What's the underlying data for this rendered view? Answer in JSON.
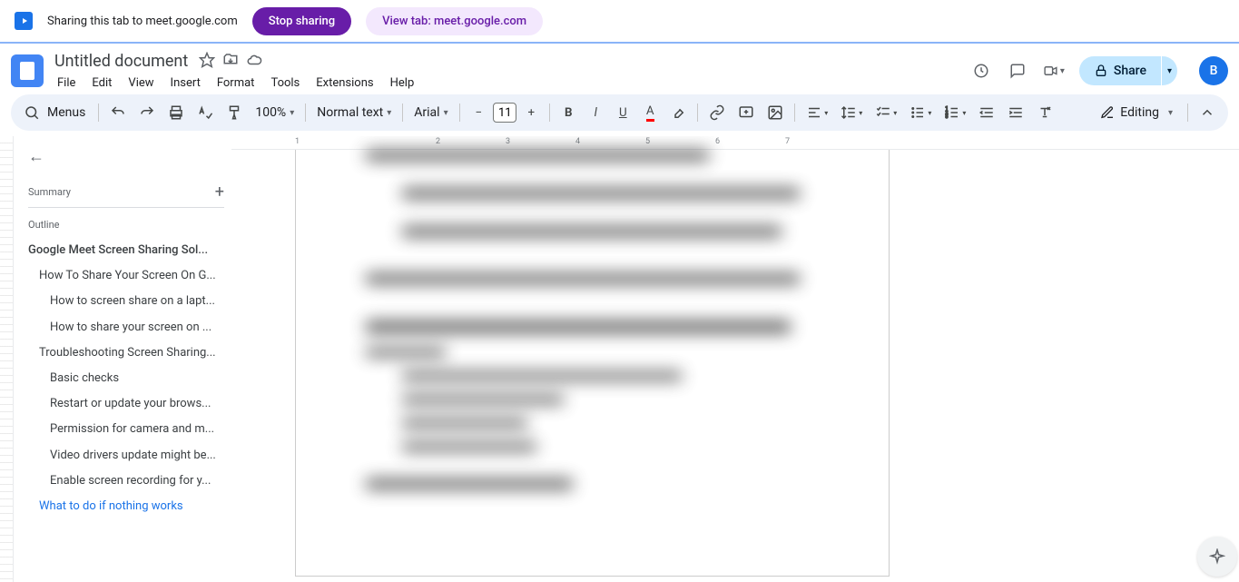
{
  "sharing_bar": {
    "text": "Sharing this tab to meet.google.com",
    "stop_label": "Stop sharing",
    "view_label": "View tab: meet.google.com"
  },
  "title_bar": {
    "doc_title": "Untitled document",
    "menus": [
      "File",
      "Edit",
      "View",
      "Insert",
      "Format",
      "Tools",
      "Extensions",
      "Help"
    ],
    "share_label": "Share",
    "avatar_letter": "B"
  },
  "toolbar": {
    "menus_label": "Menus",
    "zoom": "100%",
    "style": "Normal text",
    "font": "Arial",
    "font_size": "11",
    "editing_label": "Editing"
  },
  "outline": {
    "summary_label": "Summary",
    "outline_label": "Outline",
    "items": [
      {
        "level": 1,
        "text": "Google Meet Screen Sharing Sol...",
        "active": false
      },
      {
        "level": 2,
        "text": "How To Share Your Screen On G...",
        "active": false
      },
      {
        "level": 3,
        "text": "How to screen share on a lapt...",
        "active": false
      },
      {
        "level": 3,
        "text": "How to share your screen on ...",
        "active": false
      },
      {
        "level": 2,
        "text": "Troubleshooting Screen Sharing...",
        "active": false
      },
      {
        "level": 3,
        "text": "Basic checks",
        "active": false
      },
      {
        "level": 3,
        "text": "Restart or update your brows...",
        "active": false
      },
      {
        "level": 3,
        "text": "Permission for camera and m...",
        "active": false
      },
      {
        "level": 3,
        "text": "Video drivers update might be...",
        "active": false
      },
      {
        "level": 3,
        "text": "Enable screen recording for y...",
        "active": false
      },
      {
        "level": 2,
        "text": "What to do if nothing works",
        "active": true
      }
    ]
  },
  "ruler": {
    "numbers": [
      "1",
      "2",
      "3",
      "4",
      "5",
      "6",
      "7"
    ]
  }
}
